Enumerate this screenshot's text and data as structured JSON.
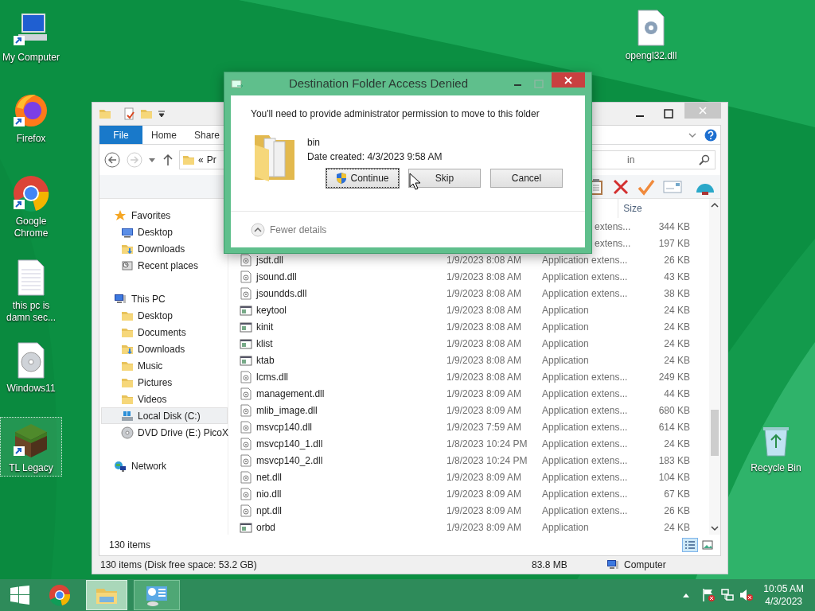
{
  "desktop_icons": [
    {
      "label": "My Computer",
      "kind": "computer",
      "selected": false
    },
    {
      "label": "Firefox",
      "kind": "firefox",
      "selected": false
    },
    {
      "label": "Google Chrome",
      "kind": "chrome",
      "selected": false
    },
    {
      "label": "this pc is damn sec...",
      "kind": "textfile",
      "selected": false
    },
    {
      "label": "Windows11",
      "kind": "disc",
      "selected": false
    },
    {
      "label": "TL Legacy",
      "kind": "block",
      "selected": true
    },
    {
      "label": "opengl32.dll",
      "kind": "dll",
      "selected": false
    },
    {
      "label": "Recycle Bin",
      "kind": "bin",
      "selected": false
    }
  ],
  "explorer": {
    "ribbon_tabs": [
      {
        "label": "File",
        "selected": true
      },
      {
        "label": "Home",
        "selected": false
      },
      {
        "label": "Share",
        "selected": false
      }
    ],
    "address": {
      "chevron": "«",
      "path": "Pr"
    },
    "search": {
      "value": "in"
    },
    "nav": [
      {
        "label": "Favorites",
        "kind": "star",
        "selected": false,
        "children": [
          {
            "label": "Desktop",
            "kind": "desktop",
            "selected": false
          },
          {
            "label": "Downloads",
            "kind": "download",
            "selected": false
          },
          {
            "label": "Recent places",
            "kind": "recent",
            "selected": false
          }
        ]
      },
      {
        "label": "This PC",
        "kind": "pc",
        "selected": false,
        "children": [
          {
            "label": "Desktop",
            "kind": "folder",
            "selected": false
          },
          {
            "label": "Documents",
            "kind": "folder",
            "selected": false
          },
          {
            "label": "Downloads",
            "kind": "download",
            "selected": false
          },
          {
            "label": "Music",
            "kind": "folder",
            "selected": false
          },
          {
            "label": "Pictures",
            "kind": "folder",
            "selected": false
          },
          {
            "label": "Videos",
            "kind": "folder",
            "selected": false
          },
          {
            "label": "Local Disk (C:)",
            "kind": "drive",
            "selected": true
          },
          {
            "label": "DVD Drive (E:) PicoX",
            "kind": "dvd",
            "selected": false
          }
        ]
      },
      {
        "label": "Network",
        "kind": "network",
        "selected": false
      }
    ],
    "columns": {
      "size": "Size"
    },
    "rows": [
      {
        "kind": "hidden",
        "type": "extens...",
        "size": "344 KB"
      },
      {
        "kind": "hidden",
        "type": "extens...",
        "size": "197 KB"
      },
      {
        "kind": "dll",
        "name": "jsdt.dll",
        "date": "1/9/2023 8:08 AM",
        "type": "Application extens...",
        "size": "26 KB"
      },
      {
        "kind": "dll",
        "name": "jsound.dll",
        "date": "1/9/2023 8:08 AM",
        "type": "Application extens...",
        "size": "43 KB"
      },
      {
        "kind": "dll",
        "name": "jsoundds.dll",
        "date": "1/9/2023 8:08 AM",
        "type": "Application extens...",
        "size": "38 KB"
      },
      {
        "kind": "app",
        "name": "keytool",
        "date": "1/9/2023 8:08 AM",
        "type": "Application",
        "size": "24 KB"
      },
      {
        "kind": "app",
        "name": "kinit",
        "date": "1/9/2023 8:08 AM",
        "type": "Application",
        "size": "24 KB"
      },
      {
        "kind": "app",
        "name": "klist",
        "date": "1/9/2023 8:08 AM",
        "type": "Application",
        "size": "24 KB"
      },
      {
        "kind": "app",
        "name": "ktab",
        "date": "1/9/2023 8:08 AM",
        "type": "Application",
        "size": "24 KB"
      },
      {
        "kind": "dll",
        "name": "lcms.dll",
        "date": "1/9/2023 8:08 AM",
        "type": "Application extens...",
        "size": "249 KB"
      },
      {
        "kind": "dll",
        "name": "management.dll",
        "date": "1/9/2023 8:09 AM",
        "type": "Application extens...",
        "size": "44 KB"
      },
      {
        "kind": "dll",
        "name": "mlib_image.dll",
        "date": "1/9/2023 8:09 AM",
        "type": "Application extens...",
        "size": "680 KB"
      },
      {
        "kind": "dll",
        "name": "msvcp140.dll",
        "date": "1/9/2023 7:59 AM",
        "type": "Application extens...",
        "size": "614 KB"
      },
      {
        "kind": "dll",
        "name": "msvcp140_1.dll",
        "date": "1/8/2023 10:24 PM",
        "type": "Application extens...",
        "size": "24 KB"
      },
      {
        "kind": "dll",
        "name": "msvcp140_2.dll",
        "date": "1/8/2023 10:24 PM",
        "type": "Application extens...",
        "size": "183 KB"
      },
      {
        "kind": "dll",
        "name": "net.dll",
        "date": "1/9/2023 8:09 AM",
        "type": "Application extens...",
        "size": "104 KB"
      },
      {
        "kind": "dll",
        "name": "nio.dll",
        "date": "1/9/2023 8:09 AM",
        "type": "Application extens...",
        "size": "67 KB"
      },
      {
        "kind": "dll",
        "name": "npt.dll",
        "date": "1/9/2023 8:09 AM",
        "type": "Application extens...",
        "size": "26 KB"
      },
      {
        "kind": "app",
        "name": "orbd",
        "date": "1/9/2023 8:09 AM",
        "type": "Application",
        "size": "24 KB"
      }
    ],
    "item_count": "130 items",
    "view_buttons": [
      {
        "kind": "details",
        "selected": true
      },
      {
        "kind": "tiles",
        "selected": false
      }
    ],
    "status_bar": {
      "summary": "130 items (Disk free space: 53.2 GB)",
      "size": "83.8 MB",
      "location": "Computer"
    }
  },
  "dialog": {
    "title": "Destination Folder Access Denied",
    "message": "You'll need to provide administrator permission to move to this folder",
    "folder_name": "bin",
    "date_created": "Date created: 4/3/2023 9:58 AM",
    "buttons": [
      {
        "label": "Continue",
        "shield": true,
        "focused": true
      },
      {
        "label": "Skip",
        "shield": false,
        "focused": false
      },
      {
        "label": "Cancel",
        "shield": false,
        "focused": false
      }
    ],
    "details_toggle": "Fewer details"
  },
  "taskbar": {
    "apps": [
      {
        "kind": "chrome",
        "selected": false
      },
      {
        "kind": "explorer",
        "selected": true
      },
      {
        "kind": "control",
        "selected": false
      }
    ],
    "time": "10:05 AM",
    "date": "4/3/2023"
  }
}
